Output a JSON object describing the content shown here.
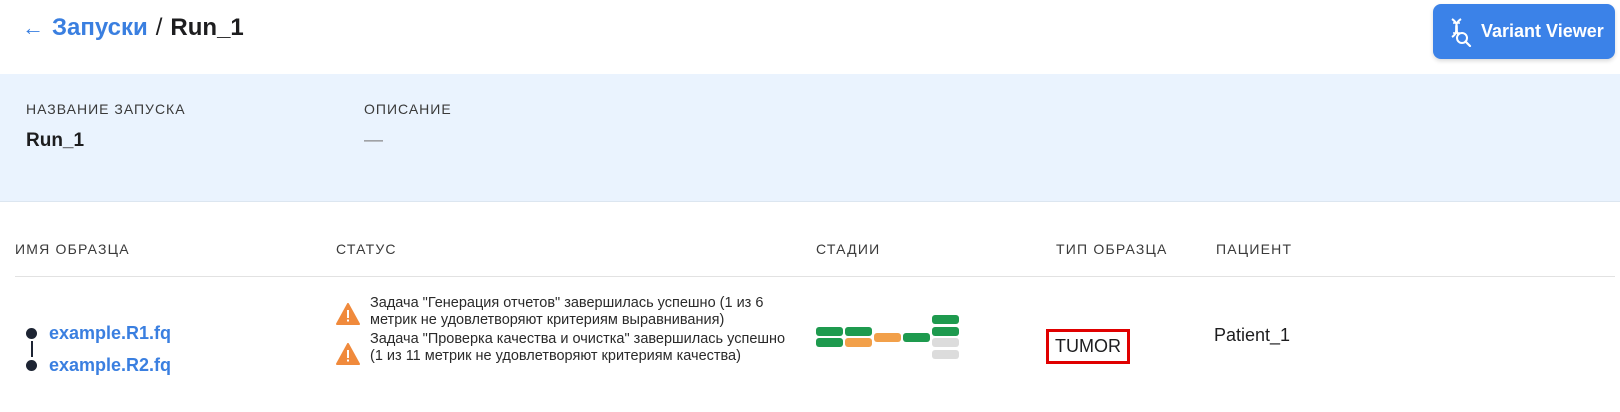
{
  "header": {
    "back_arrow": "←",
    "breadcrumb_parent": "Запуски",
    "breadcrumb_separator": "/",
    "breadcrumb_current": "Run_1",
    "variant_viewer_label": "Variant Viewer",
    "variant_viewer_icon": "dna-search-icon"
  },
  "info": {
    "run_name_label": "НАЗВАНИЕ ЗАПУСКА",
    "run_name_value": "Run_1",
    "description_label": "ОПИСАНИЕ",
    "description_value": "—"
  },
  "table": {
    "columns": [
      "ИМЯ ОБРАЗЦА",
      "СТАТУС",
      "СТАДИИ",
      "ТИП ОБРАЗЦА",
      "ПАЦИЕНТ"
    ],
    "rows": [
      {
        "samples": [
          "example.R1.fq",
          "example.R2.fq"
        ],
        "statuses": [
          "Задача \"Генерация отчетов\" завершилась успешно (1 из 6 метрик не удовлетворяют критериям выравнивания)",
          "Задача \"Проверка качества и очистка\" завершилась успешно (1 из 11 метрик не удовлетворяют критериям качества)"
        ],
        "stages": [
          [
            "success",
            "success"
          ],
          [
            "success",
            "warning"
          ],
          [
            "warning"
          ],
          [
            "success"
          ],
          [
            "success",
            "success",
            "pending",
            "pending"
          ]
        ],
        "sample_type": "TUMOR",
        "patient": "Patient_1"
      }
    ]
  },
  "colors": {
    "accent": "#3b82e8",
    "success": "#1e9a4e",
    "warning": "#f2a04a",
    "pending": "#dcdcdc",
    "warning_icon": "#f08a3c",
    "highlight_border": "#e00000",
    "info_bg": "#eaf3fe"
  }
}
